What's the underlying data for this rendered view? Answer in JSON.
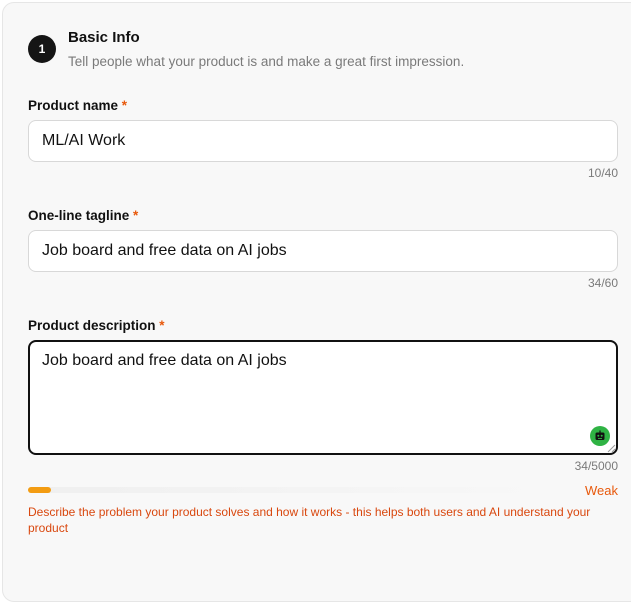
{
  "section": {
    "step_number": "1",
    "title": "Basic Info",
    "subtitle": "Tell people what your product is and make a great first impression."
  },
  "fields": {
    "product_name": {
      "label": "Product name",
      "required_marker": "*",
      "value": "ML/AI Work",
      "counter": "10/40"
    },
    "tagline": {
      "label": "One-line tagline",
      "required_marker": "*",
      "value": "Job board and free data on AI jobs",
      "counter": "34/60"
    },
    "description": {
      "label": "Product description",
      "required_marker": "*",
      "value": "Job board and free data on AI jobs",
      "counter": "34/5000"
    }
  },
  "strength": {
    "label": "Weak",
    "fraction": 0.045,
    "color": "#f39c12",
    "helper": "Describe the problem your product solves and how it works - this helps both users and AI understand your product"
  },
  "icons": {
    "assistant": "robot-icon",
    "resize": "resize-grip-icon"
  },
  "colors": {
    "accent": "#e8590c",
    "assistant_badge": "#2fb344",
    "step_badge": "#151515"
  }
}
